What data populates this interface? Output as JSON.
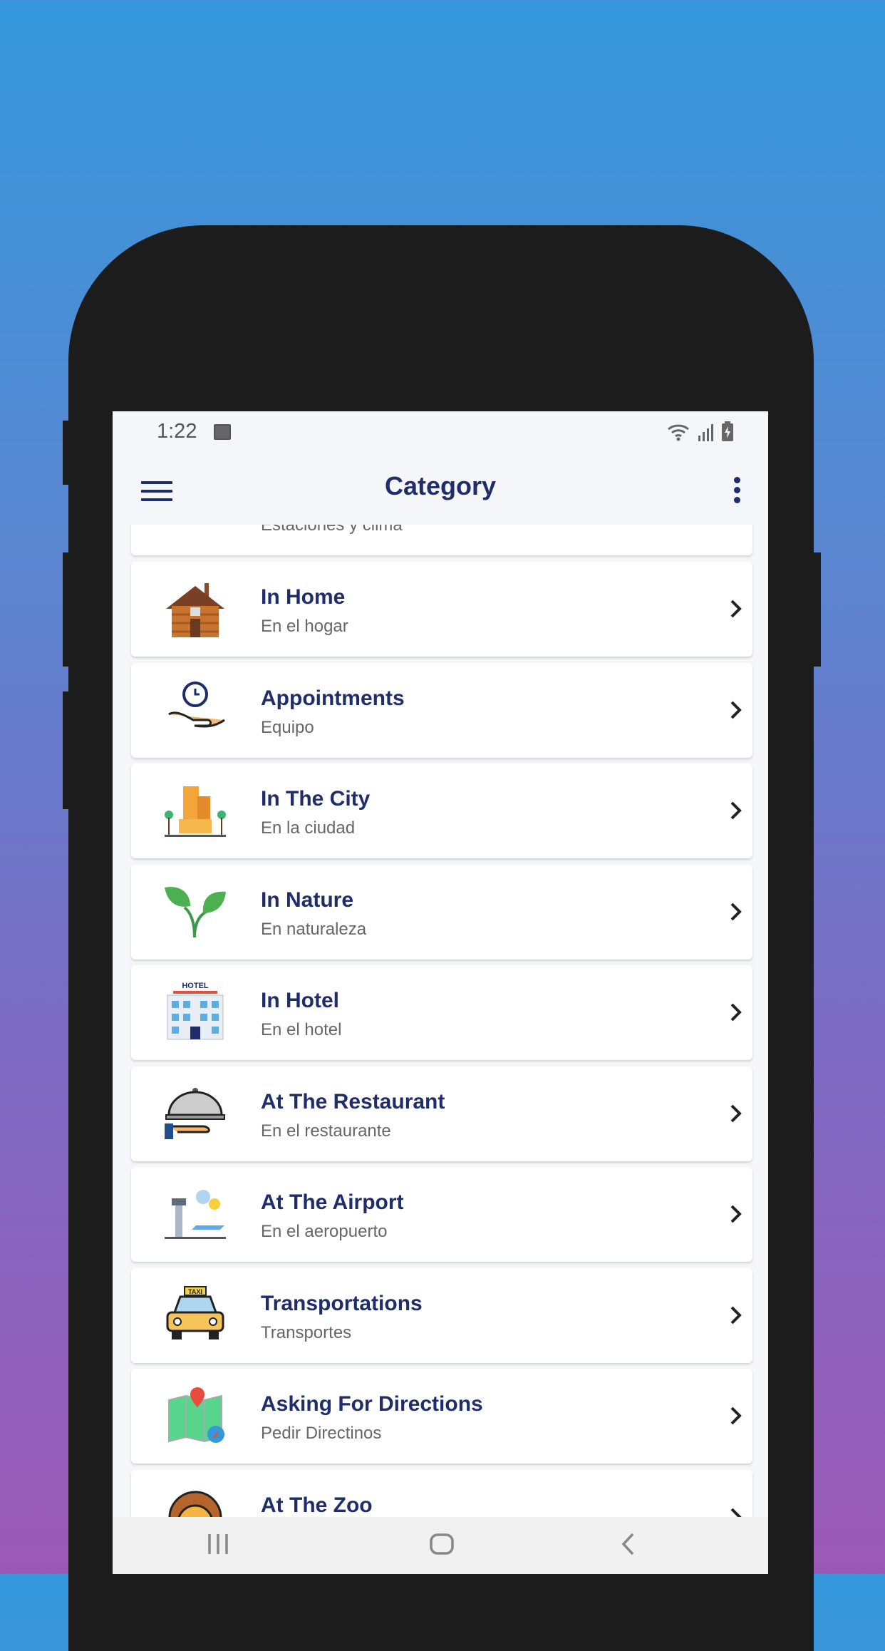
{
  "status": {
    "time": "1:22"
  },
  "toolbar": {
    "title": "Category"
  },
  "partial_item": {
    "subtitle": "Estaciones y clima"
  },
  "items": [
    {
      "title": "In Home",
      "subtitle": "En el hogar",
      "icon": "house-icon"
    },
    {
      "title": "Appointments",
      "subtitle": "Equipo",
      "icon": "clock-hand-icon"
    },
    {
      "title": "In The City",
      "subtitle": "En la ciudad",
      "icon": "city-icon"
    },
    {
      "title": "In Nature",
      "subtitle": "En naturaleza",
      "icon": "sprout-icon"
    },
    {
      "title": "In Hotel",
      "subtitle": "En el hotel",
      "icon": "hotel-icon"
    },
    {
      "title": "At The Restaurant",
      "subtitle": "En el restaurante",
      "icon": "cloche-icon"
    },
    {
      "title": "At The Airport",
      "subtitle": "En el aeropuerto",
      "icon": "airport-icon"
    },
    {
      "title": "Transportations",
      "subtitle": "Transportes",
      "icon": "taxi-icon"
    },
    {
      "title": "Asking For Directions",
      "subtitle": "Pedir Directinos",
      "icon": "map-icon"
    },
    {
      "title": "At The Zoo",
      "subtitle": "",
      "icon": "lion-icon"
    }
  ],
  "hotel_sign": "HOTEL",
  "taxi_sign": "TAXI",
  "colors": {
    "accent": "#1f2d6b",
    "bg_top": "#3598dc",
    "bg_bottom": "#9b59b6"
  }
}
